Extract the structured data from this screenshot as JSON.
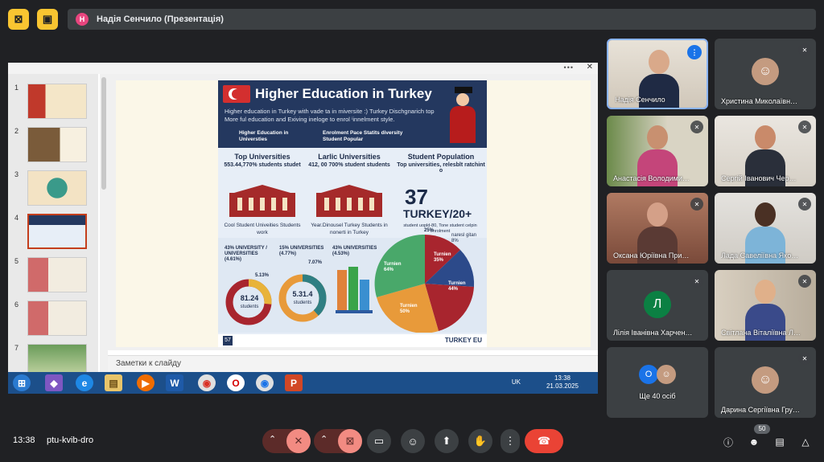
{
  "top": {
    "presenter_initial": "Н",
    "presenter_label": "Надія Сенчило (Презентація)"
  },
  "ppt": {
    "notes_placeholder": "Заметки к слайду",
    "thumb_numbers": [
      "1",
      "2",
      "3",
      "4",
      "5",
      "6",
      "7"
    ],
    "selected_slide": 4
  },
  "infographic": {
    "title": "Higher Education in Turkey",
    "description": "Higher education in Turkey with vade ta in miversite :) Turkey Dischgnarich top More ful education and Exiving ineloge to enrol ⁱinnelment style.",
    "tag1": "Higher Education in Universties",
    "tag2": "Enrolment Pace Statits diversity Student Popular",
    "col1_title": "Top Universities",
    "col1_sub": "553.44,770% students studet",
    "col1_caption": "Cool Student Univeities Students work",
    "col2_title": "Larlic Universities",
    "col2_sub": "412, 00 700% student students",
    "col2_caption": "Year.Dinousel Turkey Students in nonerti in Turkey",
    "col3_title": "Student Population",
    "col3_sub": "Top universities, relesblt ratchint o",
    "big_number": "37",
    "big_suffix": "TURKEY/20+",
    "big_caption": "student uopld-80, Tone student celpin enrolment",
    "d1_label": "43% UNIVERSITY / UNIVERSITIES (4.61%)",
    "d1_side": "5.13%",
    "d1_value": "81.24",
    "d1_unit": "students",
    "d2_label": "15% UNIVERSITIES (4.77%)",
    "d2_side": "7.07%",
    "d2_value": "5.31.4",
    "d2_unit": "students",
    "bar_label": "43% UNIVERSITIES (4.53%)",
    "pie_top": "25%",
    "pie_note": "naresl gitan 8%",
    "pie_s1": "Turnien 64%",
    "pie_s2": "Turnien 35%",
    "pie_s3": "Turnien 44%",
    "pie_s4": "Turnien 50%",
    "footer_logo": "TURKEY EU",
    "footer_num": "57"
  },
  "taskbar": {
    "lang": "UK",
    "time": "13:38",
    "date": "21.03.2025"
  },
  "participants": [
    {
      "name": "Надія Сенчило",
      "state": "speaking"
    },
    {
      "name": "Христина Миколаївн…",
      "state": "muted"
    },
    {
      "name": "Анастасія Володими…",
      "state": "muted"
    },
    {
      "name": "Сергій Іванович Чер…",
      "state": "muted"
    },
    {
      "name": "Оксана Юріївна При…",
      "state": "muted"
    },
    {
      "name": "Лада Савеліївна Яко…",
      "state": "muted"
    },
    {
      "name": "Лілія Іванівна Харчен…",
      "state": "muted",
      "initial": "Л"
    },
    {
      "name": "Світлана Віталіївна Л…",
      "state": "muted"
    },
    {
      "name": "Ще 40 осіб",
      "state": "",
      "initial": "О"
    },
    {
      "name": "Дарина Сергіївна Гру…",
      "state": "muted"
    }
  ],
  "bottom": {
    "clock": "13:38",
    "meeting_code": "ptu-kvib-dro",
    "people_count": "50"
  },
  "colors": {
    "accent_yellow": "#f9c531",
    "hangup_red": "#ea4335",
    "muted_pink": "#f28b82",
    "speaker_blue": "#1a73e8",
    "avatar_green": "#0b8043"
  }
}
